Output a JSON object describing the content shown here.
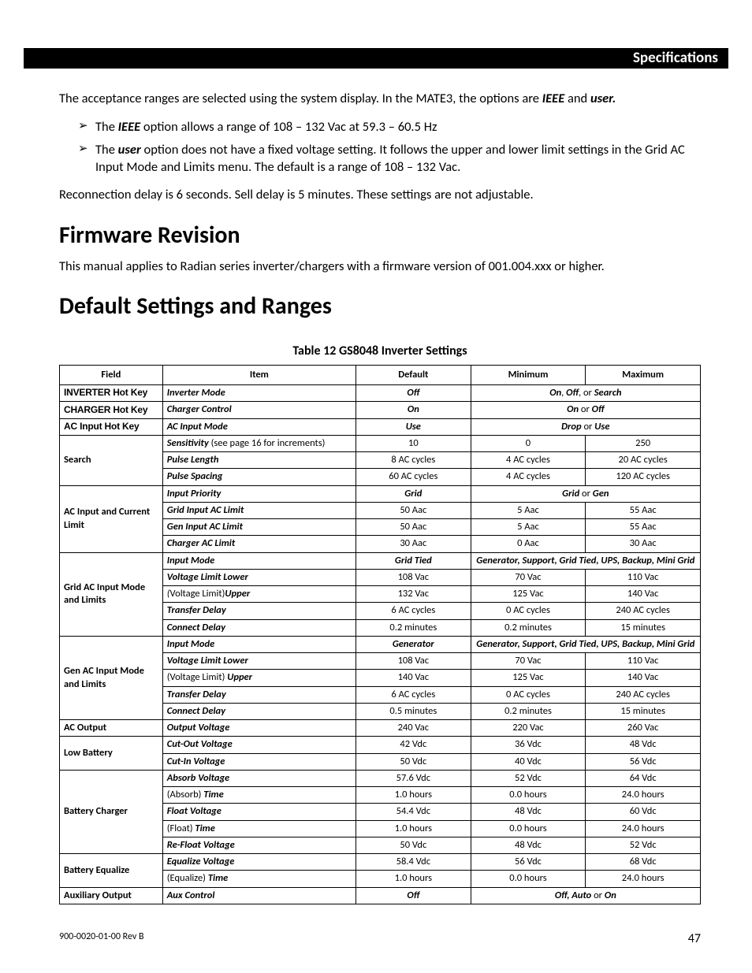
{
  "header": {
    "section": "Specifications"
  },
  "intro": {
    "p1a": "The acceptance ranges are selected using the system display.  In the MATE3, the options are ",
    "p1b": "IEEE",
    "p1c": " and ",
    "p1d": "user.",
    "bullet1a": "The ",
    "bullet1b": "IEEE",
    "bullet1c": " option allows a range of 108 – 132 Vac at 59.3 – 60.5 Hz",
    "bullet2a": "The ",
    "bullet2b": "user",
    "bullet2c": " option does not have a fixed voltage setting.  It follows the upper and lower limit settings in the Grid AC Input Mode and Limits menu.  The default is a range of 108 – 132 Vac.",
    "p2": "Reconnection delay is 6 seconds.  Sell delay is 5 minutes.  These settings are not adjustable."
  },
  "firmware": {
    "heading": "Firmware Revision",
    "text": "This manual applies to Radian series inverter/chargers with a firmware version of 001.004.xxx or higher."
  },
  "defaults": {
    "heading": "Default Settings and Ranges",
    "table_caption": "Table 12   GS8048 Inverter Settings",
    "headers": {
      "field": "Field",
      "item": "Item",
      "def": "Default",
      "min": "Minimum",
      "max": "Maximum"
    }
  },
  "rows": {
    "inv_hotkey": {
      "field": "INVERTER Hot Key",
      "item": "Inverter Mode",
      "def": "Off",
      "range_pre": "On",
      "range_mid1": ", ",
      "range_mid2": "Off",
      "range_mid3": ", or ",
      "range_post": "Search"
    },
    "chg_hotkey": {
      "field": "CHARGER Hot Key",
      "item": "Charger Control",
      "def": "On",
      "range_pre": "On",
      "range_mid": " or ",
      "range_post": "Off"
    },
    "ac_hotkey": {
      "field": "AC Input Hot Key",
      "item": "AC Input Mode",
      "def": "Use",
      "range_pre": "Drop",
      "range_mid": " or ",
      "range_post": "Use"
    },
    "search_field": "Search",
    "search_sens": {
      "item_pre": "Sensitivity",
      "item_post": " (see page 16 for increments)",
      "def": "10",
      "min": "0",
      "max": "250"
    },
    "search_pulse": {
      "item": "Pulse Length",
      "def": "8 AC cycles",
      "min": "4 AC cycles",
      "max": "20 AC cycles"
    },
    "search_space": {
      "item": "Pulse Spacing",
      "def": "60 AC cycles",
      "min": "4 AC cycles",
      "max": "120 AC cycles"
    },
    "aci_field": "AC Input and Current Limit",
    "aci_pri": {
      "item": "Input Priority",
      "def": "Grid",
      "range_pre": "Grid",
      "range_mid": " or ",
      "range_post": "Gen"
    },
    "aci_grid": {
      "item": "Grid Input AC Limit",
      "def": "50 Aac",
      "min": "5 Aac",
      "max": "55 Aac"
    },
    "aci_gen": {
      "item": "Gen Input AC Limit",
      "def": "50 Aac",
      "min": "5 Aac",
      "max": "55 Aac"
    },
    "aci_chg": {
      "item": "Charger AC Limit",
      "def": "30 Aac",
      "min": "0 Aac",
      "max": "30 Aac"
    },
    "grid_field": "Grid AC Input Mode and Limits",
    "grid_mode": {
      "item": "Input Mode",
      "def": "Grid Tied",
      "range": "Generator, Support, Grid Tied, UPS, Backup, Mini Grid"
    },
    "grid_vll": {
      "item": "Voltage Limit Lower",
      "def": "108 Vac",
      "min": "70 Vac",
      "max": "110 Vac"
    },
    "grid_vlu": {
      "item_pre": "(",
      "item_mid": "Voltage Limit)",
      "item_post": "Upper",
      "def": "132 Vac",
      "min": "125 Vac",
      "max": "140 Vac"
    },
    "grid_td": {
      "item": "Transfer Delay",
      "def": "6 AC cycles",
      "min": "0 AC cycles",
      "max": "240 AC cycles"
    },
    "grid_cd": {
      "item": "Connect Delay",
      "def": "0.2 minutes",
      "min": "0.2 minutes",
      "max": "15 minutes"
    },
    "gen_field": "Gen AC Input Mode and Limits",
    "gen_mode": {
      "item": "Input Mode",
      "def": "Generator",
      "range": "Generator, Support, Grid Tied, UPS, Backup, Mini Grid"
    },
    "gen_vll": {
      "item": "Voltage Limit Lower",
      "def": "108 Vac",
      "min": "70 Vac",
      "max": "110 Vac"
    },
    "gen_vlu": {
      "item_pre": "(Voltage Limit) ",
      "item_post": "Upper",
      "def": "140 Vac",
      "min": "125 Vac",
      "max": "140 Vac"
    },
    "gen_td": {
      "item": "Transfer Delay",
      "def": "6 AC cycles",
      "min": "0 AC cycles",
      "max": "240 AC cycles"
    },
    "gen_cd": {
      "item": "Connect Delay",
      "def": "0.5 minutes",
      "min": "0.2 minutes",
      "max": "15 minutes"
    },
    "acout": {
      "field": "AC Output",
      "item": "Output Voltage",
      "def": "240 Vac",
      "min": "220 Vac",
      "max": "260 Vac"
    },
    "lb_field": "Low Battery",
    "lb_cov": {
      "item": "Cut-Out Voltage",
      "def": "42 Vdc",
      "min": "36 Vdc",
      "max": "48 Vdc"
    },
    "lb_civ": {
      "item": "Cut-In Voltage",
      "def": "50 Vdc",
      "min": "40 Vdc",
      "max": "56 Vdc"
    },
    "bc_field": "Battery Charger",
    "bc_abs": {
      "item": "Absorb Voltage",
      "def": "57.6 Vdc",
      "min": "52 Vdc",
      "max": "64 Vdc"
    },
    "bc_abst": {
      "item_pre": "(Absorb) ",
      "item_post": "Time",
      "def": "1.0 hours",
      "min": "0.0 hours",
      "max": "24.0 hours"
    },
    "bc_flt": {
      "item": "Float Voltage",
      "def": "54.4 Vdc",
      "min": "48 Vdc",
      "max": "60 Vdc"
    },
    "bc_fltt": {
      "item_pre": "(Float) ",
      "item_post": "Time",
      "def": "1.0 hours",
      "min": "0.0 hours",
      "max": "24.0 hours"
    },
    "bc_ref": {
      "item": "Re-Float Voltage",
      "def": "50 Vdc",
      "min": "48 Vdc",
      "max": "52 Vdc"
    },
    "be_field": "Battery Equalize",
    "be_eq": {
      "item": "Equalize Voltage",
      "def": "58.4 Vdc",
      "min": "56 Vdc",
      "max": "68 Vdc"
    },
    "be_eqt": {
      "item_pre": "(Equalize) ",
      "item_post": "Time",
      "def": "1.0 hours",
      "min": "0.0 hours",
      "max": "24.0 hours"
    },
    "aux": {
      "field": "Auxiliary Output",
      "item": "Aux Control",
      "def": "Off",
      "range_pre": "Off, Auto",
      "range_mid": " or ",
      "range_post": "On"
    }
  },
  "footer": {
    "doc": "900-0020-01-00 Rev B",
    "page": "47"
  }
}
